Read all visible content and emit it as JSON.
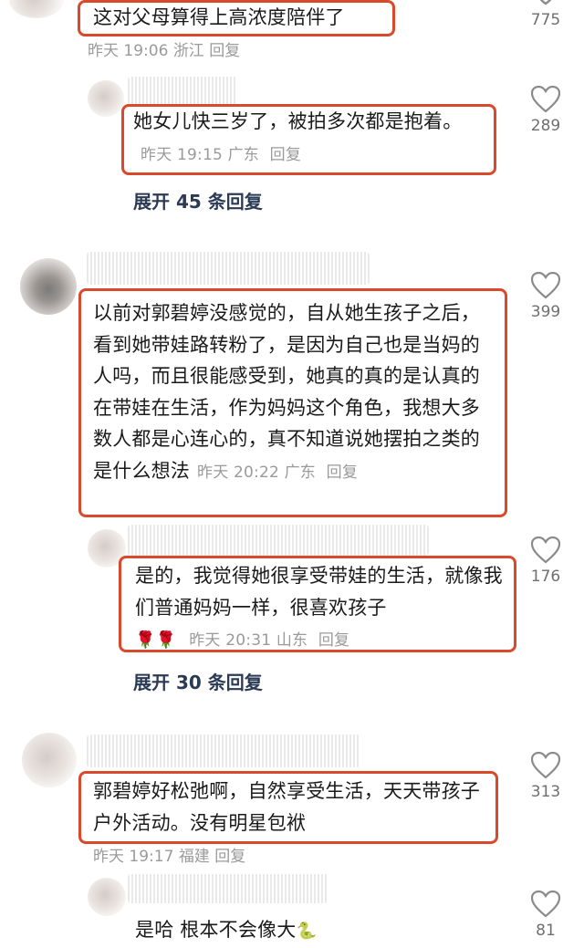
{
  "comments": [
    {
      "text": "这对父母算得上高浓度陪伴了",
      "time": "昨天 19:06",
      "location": "浙江",
      "reply": "回复",
      "likes": "775"
    },
    {
      "text": "她女儿快三岁了，被拍多次都是抱着。",
      "time": "昨天 19:15",
      "location": "广东",
      "reply": "回复",
      "likes": "289",
      "expand": "展开 45 条回复"
    },
    {
      "text": "以前对郭碧婷没感觉的，自从她生孩子之后，看到她带娃路转粉了，是因为自己也是当妈的人吗，而且很能感受到，她真的真的是认真的在带娃在生活，作为妈妈这个角色，我想大多数人都是心连心的，真不知道说她摆拍之类的是什么想法",
      "time": "昨天 20:22",
      "location": "广东",
      "reply": "回复",
      "likes": "399"
    },
    {
      "text": "是的，我觉得她很享受带娃的生活，就像我们普通妈妈一样，很喜欢孩子",
      "emoji": "🌹🌹",
      "time": "昨天 20:31",
      "location": "山东",
      "reply": "回复",
      "likes": "176",
      "expand": "展开 30 条回复"
    },
    {
      "text": "郭碧婷好松弛啊，自然享受生活，天天带孩子户外活动。没有明星包袱",
      "time": "昨天 19:17",
      "location": "福建",
      "reply": "回复",
      "likes": "313"
    },
    {
      "text": "是哈 根本不会像大",
      "emoji": "🐍",
      "likes": "81"
    }
  ],
  "colors": {
    "highlight": "#d94a2b",
    "meta": "#9a9a9a",
    "expand": "#2b3a55"
  },
  "icons": {
    "like": "heart-outline-icon"
  }
}
